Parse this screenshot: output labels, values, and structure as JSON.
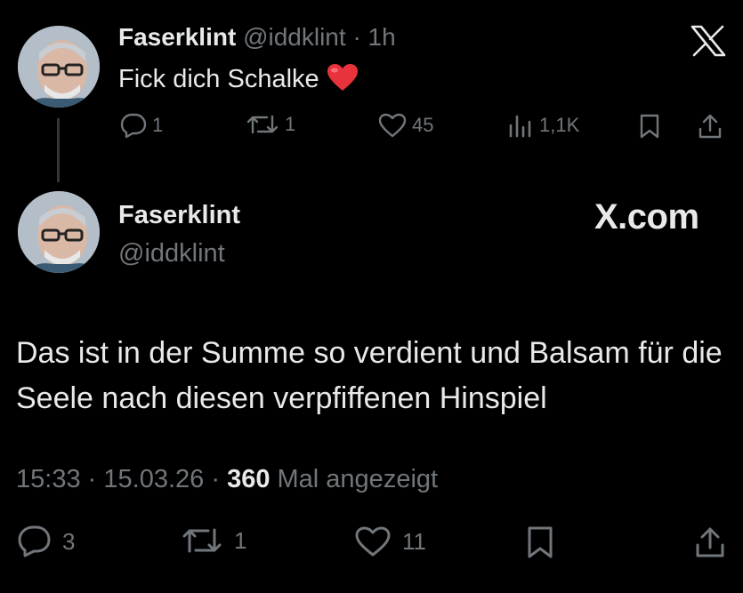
{
  "tweet1": {
    "display_name": "Faserklint",
    "handle": "@iddklint",
    "separator": "·",
    "time": "1h",
    "text": "Fick dich Schalke",
    "emoji": "heart",
    "replies": "1",
    "reposts": "1",
    "likes": "45",
    "views": "1,1K"
  },
  "tweet2": {
    "display_name": "Faserklint",
    "handle": "@iddklint",
    "brand": "X.com",
    "body": "Das ist in der Summe so verdient und Balsam für die Seele nach diesen verpfiffenen Hinspiel",
    "time": "15:33",
    "separator": "·",
    "date": "15.03.26",
    "views_count": "360",
    "views_label": "Mal angezeigt",
    "replies": "3",
    "reposts": "1",
    "likes": "11"
  },
  "icons": {
    "x_logo": "x-logo-icon",
    "reply": "reply-icon",
    "repost": "repost-icon",
    "like": "heart-icon",
    "views": "views-icon",
    "bookmark": "bookmark-icon",
    "share": "share-icon"
  },
  "colors": {
    "background": "#000000",
    "text": "#e7e9ea",
    "muted": "#71767b",
    "thread_line": "#333639",
    "heart_emoji": "#e8323c"
  }
}
